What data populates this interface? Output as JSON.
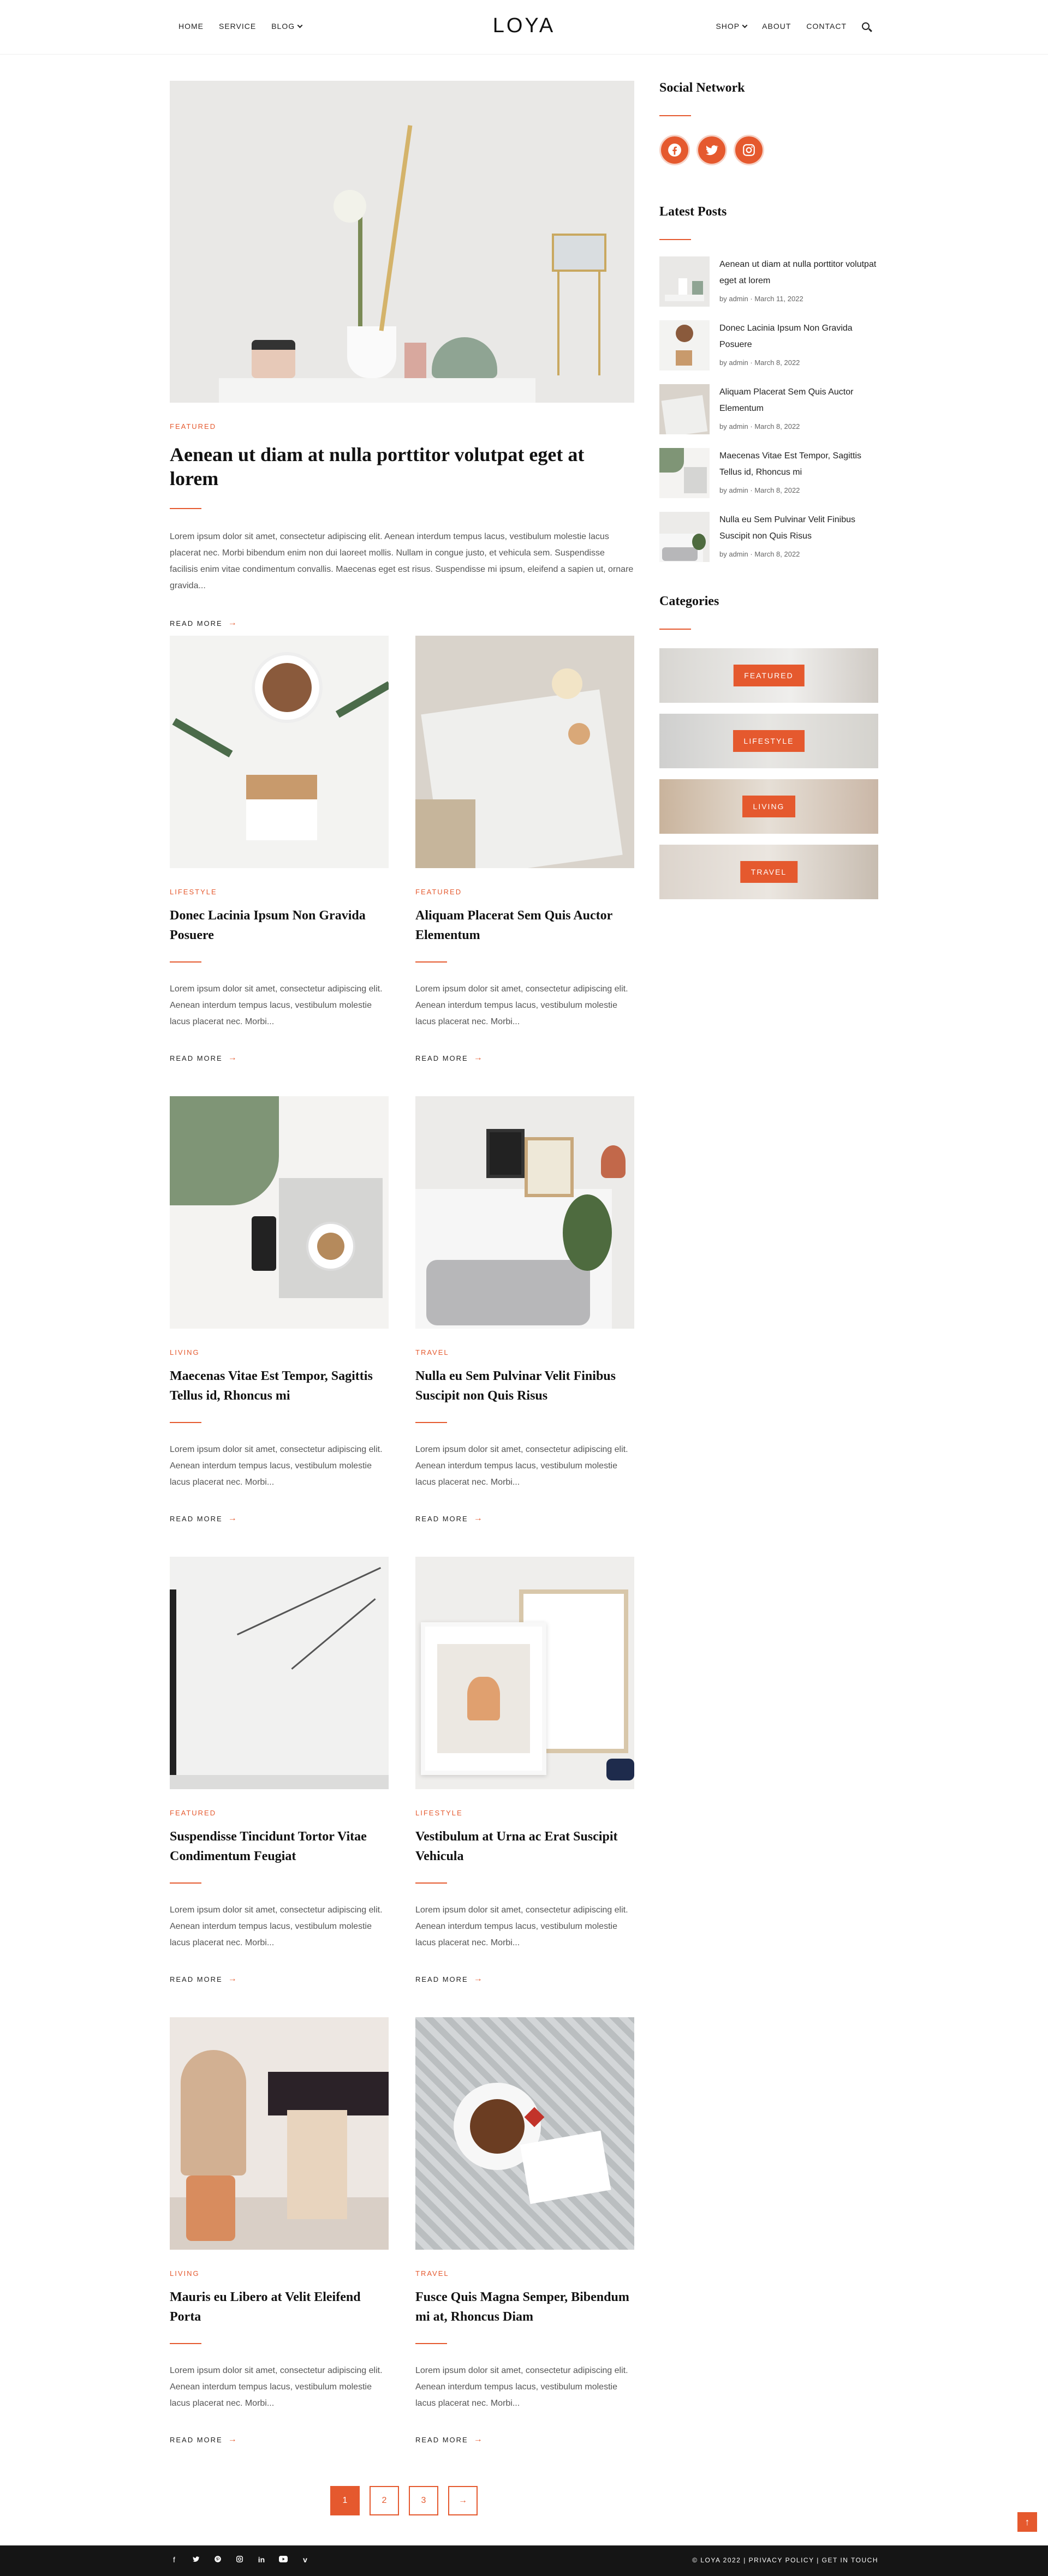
{
  "header": {
    "logo": "LOYA",
    "nav_left": [
      {
        "label": "HOME"
      },
      {
        "label": "SERVICE"
      },
      {
        "label": "BLOG"
      }
    ],
    "nav_right": [
      {
        "label": "SHOP"
      },
      {
        "label": "ABOUT"
      },
      {
        "label": "CONTACT"
      }
    ]
  },
  "featured": {
    "category": "FEATURED",
    "title": "Aenean ut diam at nulla porttitor volutpat eget at lorem",
    "excerpt": "Lorem ipsum dolor sit amet, consectetur adipiscing elit. Aenean interdum tempus lacus, vestibulum molestie lacus placerat nec. Morbi bibendum enim non dui laoreet mollis. Nullam in congue justo, et vehicula sem. Suspendisse facilisis enim vitae condimentum convallis. Maecenas eget est risus. Suspendisse mi ipsum, eleifend a sapien ut, ornare gravida...",
    "read_more": "READ MORE"
  },
  "posts": [
    {
      "category": "LIFESTYLE",
      "title": "Donec Lacinia Ipsum Non Gravida Posuere",
      "excerpt": "Lorem ipsum dolor sit amet, consectetur adipiscing elit. Aenean interdum tempus lacus, vestibulum molestie lacus placerat nec. Morbi...",
      "read_more": "READ MORE"
    },
    {
      "category": "FEATURED",
      "title": "Aliquam Placerat Sem Quis Auctor Elementum",
      "excerpt": "Lorem ipsum dolor sit amet, consectetur adipiscing elit. Aenean interdum tempus lacus, vestibulum molestie lacus placerat nec. Morbi...",
      "read_more": "READ MORE"
    },
    {
      "category": "LIVING",
      "title": "Maecenas Vitae Est Tempor, Sagittis Tellus id, Rhoncus mi",
      "excerpt": "Lorem ipsum dolor sit amet, consectetur adipiscing elit. Aenean interdum tempus lacus, vestibulum molestie lacus placerat nec. Morbi...",
      "read_more": "READ MORE"
    },
    {
      "category": "TRAVEL",
      "title": "Nulla eu Sem Pulvinar Velit Finibus Suscipit non Quis Risus",
      "excerpt": "Lorem ipsum dolor sit amet, consectetur adipiscing elit. Aenean interdum tempus lacus, vestibulum molestie lacus placerat nec. Morbi...",
      "read_more": "READ MORE"
    },
    {
      "category": "FEATURED",
      "title": "Suspendisse Tincidunt Tortor Vitae Condimentum Feugiat",
      "excerpt": "Lorem ipsum dolor sit amet, consectetur adipiscing elit. Aenean interdum tempus lacus, vestibulum molestie lacus placerat nec. Morbi...",
      "read_more": "READ MORE"
    },
    {
      "category": "LIFESTYLE",
      "title": "Vestibulum at Urna ac Erat Suscipit Vehicula",
      "excerpt": "Lorem ipsum dolor sit amet, consectetur adipiscing elit. Aenean interdum tempus lacus, vestibulum molestie lacus placerat nec. Morbi...",
      "read_more": "READ MORE"
    },
    {
      "category": "LIVING",
      "title": "Mauris eu Libero at Velit Eleifend Porta",
      "excerpt": "Lorem ipsum dolor sit amet, consectetur adipiscing elit. Aenean interdum tempus lacus, vestibulum molestie lacus placerat nec. Morbi...",
      "read_more": "READ MORE"
    },
    {
      "category": "TRAVEL",
      "title": "Fusce Quis Magna Semper, Bibendum mi at, Rhoncus Diam",
      "excerpt": "Lorem ipsum dolor sit amet, consectetur adipiscing elit. Aenean interdum tempus lacus, vestibulum molestie lacus placerat nec. Morbi...",
      "read_more": "READ MORE"
    }
  ],
  "sidebar": {
    "social_title": "Social Network",
    "social_icons": [
      "facebook-icon",
      "twitter-icon",
      "instagram-icon"
    ],
    "latest_title": "Latest Posts",
    "latest": [
      {
        "title": "Aenean ut diam at nulla porttitor volutpat eget at lorem",
        "author": "by admin",
        "date": "March 11, 2022"
      },
      {
        "title": "Donec Lacinia Ipsum Non Gravida Posuere",
        "author": "by admin",
        "date": "March 8, 2022"
      },
      {
        "title": "Aliquam Placerat Sem Quis Auctor Elementum",
        "author": "by admin",
        "date": "March 8, 2022"
      },
      {
        "title": "Maecenas Vitae Est Tempor, Sagittis Tellus id, Rhoncus mi",
        "author": "by admin",
        "date": "March 8, 2022"
      },
      {
        "title": "Nulla eu Sem Pulvinar Velit Finibus Suscipit non Quis Risus",
        "author": "by admin",
        "date": "March 8, 2022"
      }
    ],
    "categories_title": "Categories",
    "categories": [
      "FEATURED",
      "LIFESTYLE",
      "LIVING",
      "TRAVEL"
    ]
  },
  "pagination": {
    "pages": [
      "1",
      "2",
      "3"
    ],
    "active": "1",
    "next_icon": "arrow-right-icon"
  },
  "footer": {
    "social_icons": [
      "facebook-icon",
      "twitter-icon",
      "pinterest-icon",
      "instagram-icon",
      "linkedin-icon",
      "youtube-icon",
      "vimeo-icon"
    ],
    "copyright": "© LOYA 2022 | PRIVACY POLICY | GET IN TOUCH"
  },
  "colors": {
    "accent": "#e5592e",
    "footer_bg": "#151515"
  }
}
